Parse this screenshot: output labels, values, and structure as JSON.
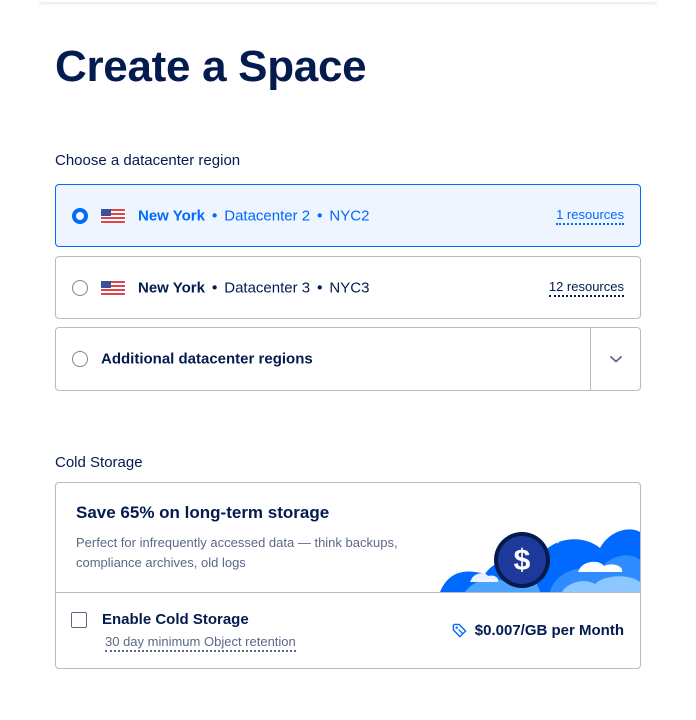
{
  "page": {
    "title": "Create a Space"
  },
  "region_section": {
    "label": "Choose a datacenter region",
    "options": [
      {
        "city": "New York",
        "separator": "•",
        "datacenter": "Datacenter 2",
        "code": "NYC2",
        "resources": "1 resources",
        "flag_icon": "us-flag-icon",
        "selected": true
      },
      {
        "city": "New York",
        "separator": "•",
        "datacenter": "Datacenter 3",
        "code": "NYC3",
        "resources": "12 resources",
        "flag_icon": "us-flag-icon",
        "selected": false
      }
    ],
    "additional": {
      "label": "Additional datacenter regions",
      "toggle_icon": "chevron-down-icon"
    }
  },
  "cold_storage": {
    "label": "Cold Storage",
    "promo_heading": "Save 65% on long-term storage",
    "promo_description": "Perfect for infrequently accessed data — think backups, compliance archives, old logs",
    "enable_label": "Enable Cold Storage",
    "retention_note": "30 day minimum Object retention",
    "price": "$0.007/GB per Month",
    "price_icon": "price-tag-icon",
    "enabled": false
  },
  "colors": {
    "accent": "#0069ff",
    "text": "#031b4e",
    "muted": "#5b6987",
    "border": "#b5bac9",
    "selected_bg": "#eef5ff"
  }
}
